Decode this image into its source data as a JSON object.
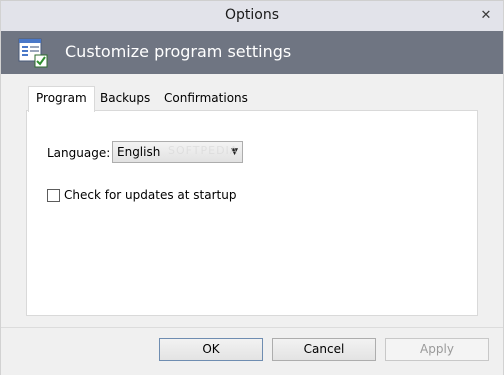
{
  "window": {
    "title": "Options"
  },
  "banner": {
    "title": "Customize program settings",
    "icon": "settings-document-icon"
  },
  "tabs": [
    {
      "label": "Program",
      "active": true
    },
    {
      "label": "Backups",
      "active": false
    },
    {
      "label": "Confirmations",
      "active": false
    }
  ],
  "program": {
    "language_label": "Language:",
    "language_value": "English",
    "check_updates_label": "Check for updates at startup",
    "check_updates_checked": false
  },
  "watermark": "SOFTPEDIA",
  "buttons": {
    "ok": "OK",
    "cancel": "Cancel",
    "apply": "Apply"
  }
}
